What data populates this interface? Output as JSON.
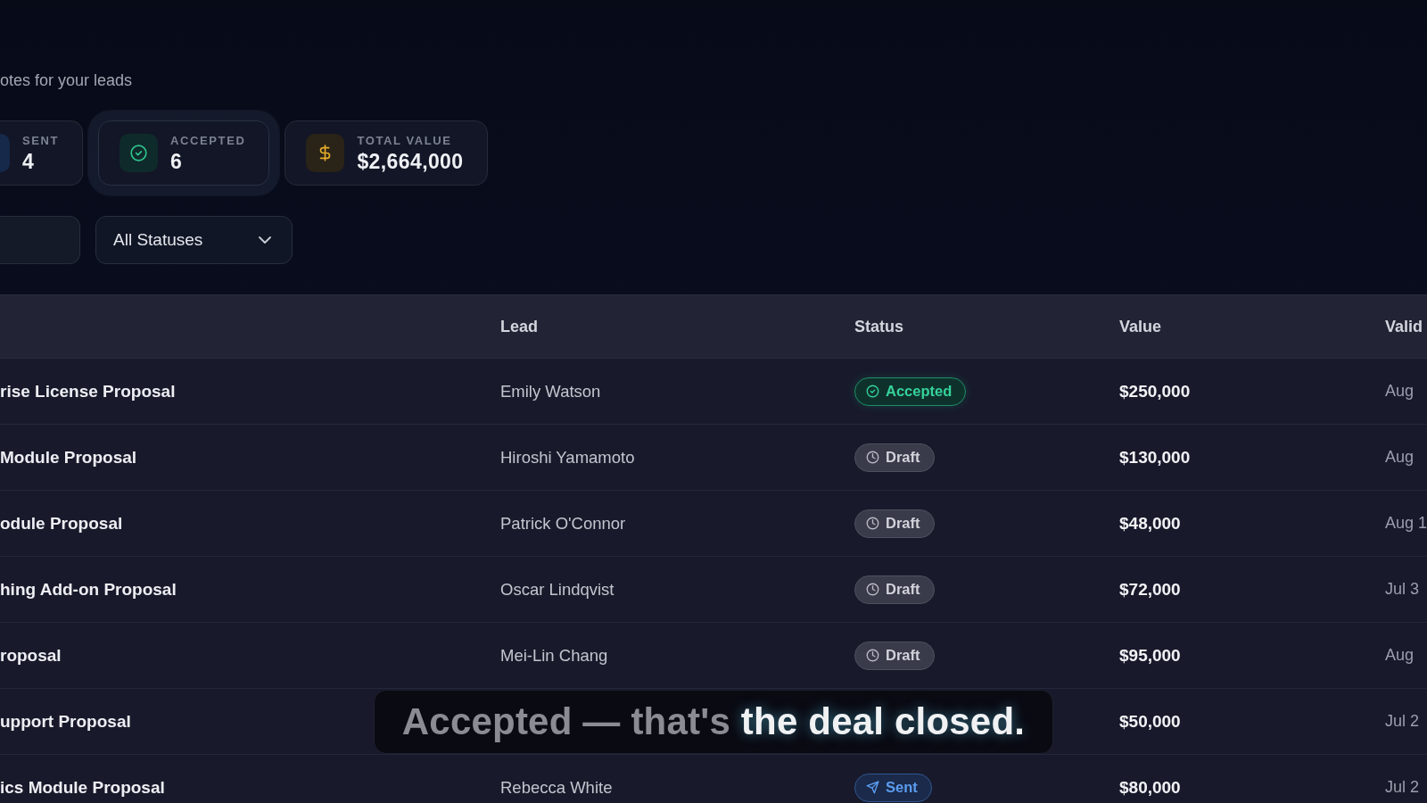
{
  "header": {
    "subtitle": "otes for your leads"
  },
  "stats": [
    {
      "kind": "sent",
      "label": "SENT",
      "value": "4",
      "highlighted": false
    },
    {
      "kind": "accepted",
      "label": "ACCEPTED",
      "value": "6",
      "highlighted": true
    },
    {
      "kind": "total",
      "label": "TOTAL VALUE",
      "value": "$2,664,000",
      "highlighted": false
    }
  ],
  "filters": {
    "status_dropdown": {
      "value": "All Statuses"
    }
  },
  "table": {
    "columns": [
      "Lead",
      "Status",
      "Value",
      "Valid"
    ],
    "rows": [
      {
        "title": "rise License Proposal",
        "lead": "Emily Watson",
        "status": {
          "kind": "accepted",
          "label": "Accepted"
        },
        "value": "$250,000",
        "valid": "Aug"
      },
      {
        "title": "Module Proposal",
        "lead": "Hiroshi Yamamoto",
        "status": {
          "kind": "draft",
          "label": "Draft"
        },
        "value": "$130,000",
        "valid": "Aug"
      },
      {
        "title": "odule Proposal",
        "lead": "Patrick O'Connor",
        "status": {
          "kind": "draft",
          "label": "Draft"
        },
        "value": "$48,000",
        "valid": "Aug 1"
      },
      {
        "title": "hing Add-on Proposal",
        "lead": "Oscar Lindqvist",
        "status": {
          "kind": "draft",
          "label": "Draft"
        },
        "value": "$72,000",
        "valid": "Jul 3"
      },
      {
        "title": "roposal",
        "lead": "Mei-Lin Chang",
        "status": {
          "kind": "draft",
          "label": "Draft"
        },
        "value": "$95,000",
        "valid": "Aug"
      },
      {
        "title": "upport Proposal",
        "value": "$50,000",
        "valid": "Jul 2"
      },
      {
        "title": "ics Module Proposal",
        "lead": "Rebecca White",
        "status": {
          "kind": "sent",
          "label": "Sent"
        },
        "value": "$80,000",
        "valid": "Jul 2"
      }
    ]
  },
  "caption": "Accepted — that's **the deal closed.**"
}
